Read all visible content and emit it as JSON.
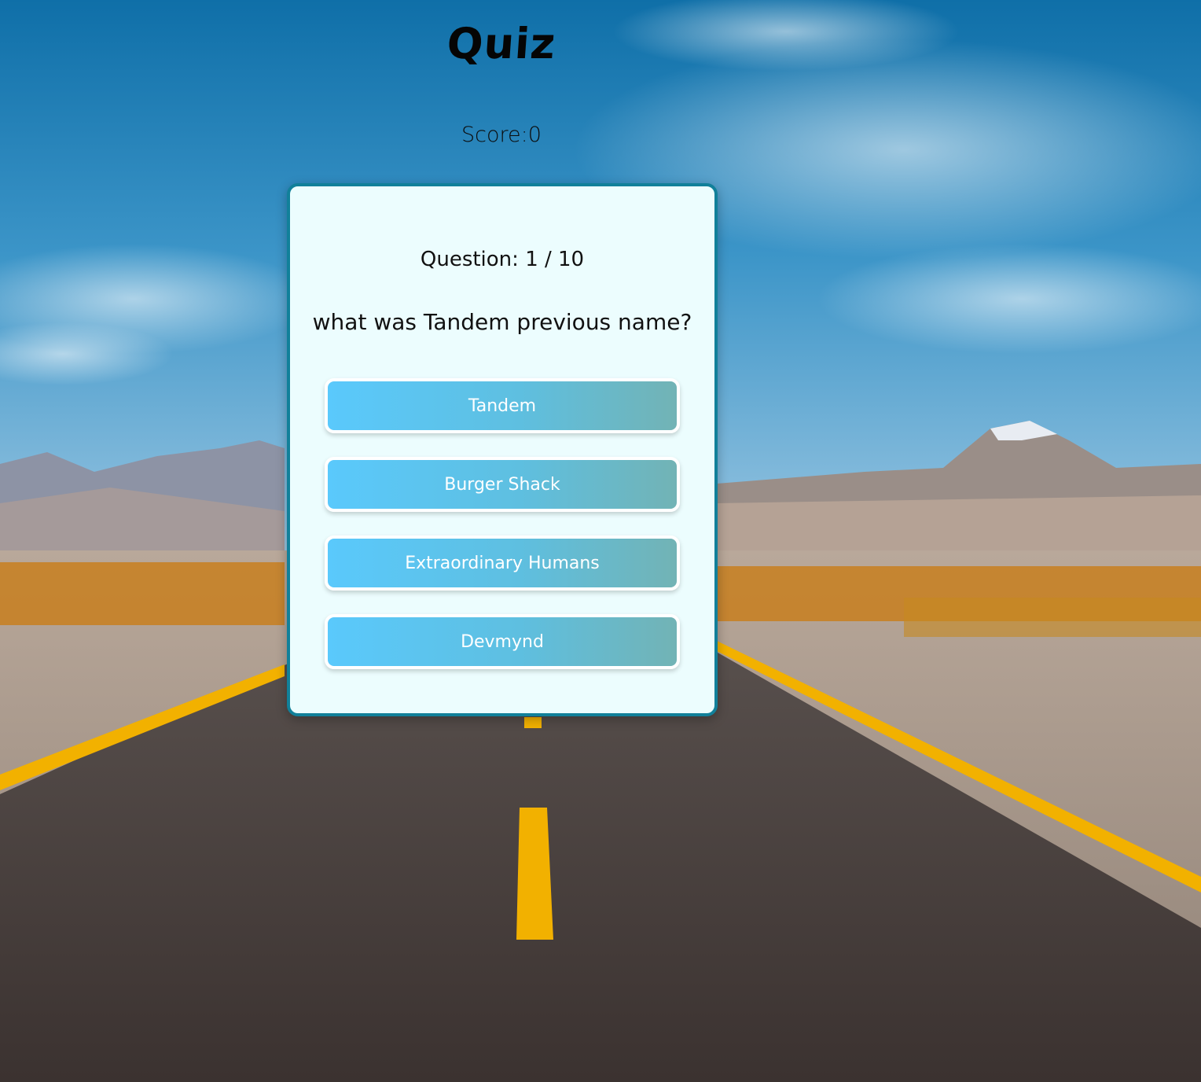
{
  "header": {
    "title": "Quiz",
    "score_label": "Score:0"
  },
  "quiz": {
    "counter": "Question: 1 / 10",
    "question": "what was Tandem previous name?",
    "answers": [
      {
        "label": "Tandem"
      },
      {
        "label": "Burger Shack"
      },
      {
        "label": "Extraordinary Humans"
      },
      {
        "label": "Devmynd"
      }
    ]
  },
  "colors": {
    "card_background": "#ecfdfe",
    "card_border": "#11809a",
    "answer_gradient_start": "#5ac9fc",
    "answer_gradient_end": "#72b3b5"
  },
  "background": {
    "description_icon": "desert-road-landscape"
  }
}
